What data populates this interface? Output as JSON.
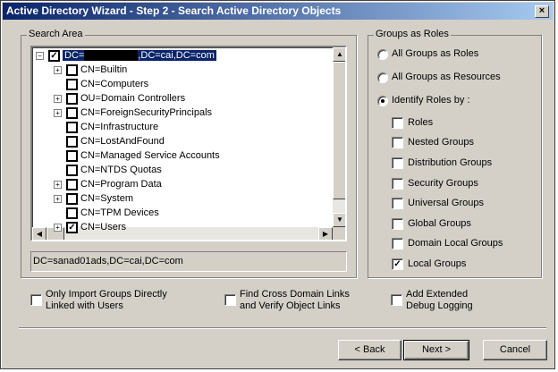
{
  "window": {
    "title": "Active Directory Wizard - Step 2 - Search Active Directory Objects",
    "close": "×"
  },
  "search_area": {
    "legend": "Search Area",
    "root": {
      "prefix": "DC=",
      "suffix": ",DC=cai,DC=com",
      "checked": true
    },
    "items": [
      {
        "label": "CN=Builtin",
        "expandable": true,
        "checked": false
      },
      {
        "label": "CN=Computers",
        "expandable": false,
        "checked": false
      },
      {
        "label": "OU=Domain Controllers",
        "expandable": true,
        "checked": false
      },
      {
        "label": "CN=ForeignSecurityPrincipals",
        "expandable": true,
        "checked": false
      },
      {
        "label": "CN=Infrastructure",
        "expandable": false,
        "checked": false
      },
      {
        "label": "CN=LostAndFound",
        "expandable": false,
        "checked": false
      },
      {
        "label": "CN=Managed Service Accounts",
        "expandable": false,
        "checked": false
      },
      {
        "label": "CN=NTDS Quotas",
        "expandable": false,
        "checked": false
      },
      {
        "label": "CN=Program Data",
        "expandable": true,
        "checked": false
      },
      {
        "label": "CN=System",
        "expandable": true,
        "checked": false
      },
      {
        "label": "CN=TPM Devices",
        "expandable": false,
        "checked": false
      },
      {
        "label": "CN=Users",
        "expandable": true,
        "checked": true
      }
    ],
    "selected_path": "DC=sanad01ads,DC=cai,DC=com"
  },
  "groups_as_roles": {
    "legend": "Groups as Roles",
    "radios": [
      {
        "label": "All Groups as Roles",
        "selected": false
      },
      {
        "label": "All Groups as Resources",
        "selected": false
      },
      {
        "label": "Identify Roles by :",
        "selected": true
      }
    ],
    "checkboxes": [
      {
        "label": "Roles",
        "checked": false
      },
      {
        "label": "Nested Groups",
        "checked": false
      },
      {
        "label": "Distribution Groups",
        "checked": false
      },
      {
        "label": "Security Groups",
        "checked": false
      },
      {
        "label": "Universal Groups",
        "checked": false
      },
      {
        "label": "Global Groups",
        "checked": false
      },
      {
        "label": "Domain Local Groups",
        "checked": false
      },
      {
        "label": "Local Groups",
        "checked": true
      }
    ]
  },
  "options": [
    {
      "line1": "Only Import Groups Directly",
      "line2": "Linked with Users",
      "checked": false
    },
    {
      "line1": "Find Cross Domain Links",
      "line2": "and Verify Object Links",
      "checked": false
    },
    {
      "line1": "Add Extended",
      "line2": "Debug Logging",
      "checked": false
    }
  ],
  "buttons": {
    "back": "< Back",
    "next": "Next >",
    "cancel": "Cancel"
  }
}
